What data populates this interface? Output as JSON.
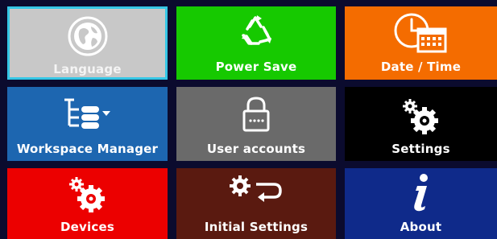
{
  "tiles": [
    {
      "id": "language",
      "label": "Language",
      "icon": "globe-icon",
      "color": "#c8c8c8",
      "selected": true
    },
    {
      "id": "power-save",
      "label": "Power Save",
      "icon": "recycle-icon",
      "color": "#16c900"
    },
    {
      "id": "date-time",
      "label": "Date / Time",
      "icon": "clock-calendar-icon",
      "color": "#f46c00"
    },
    {
      "id": "workspace-manager",
      "label": "Workspace Manager",
      "icon": "tree-list-icon",
      "color": "#1d66b0"
    },
    {
      "id": "user-accounts",
      "label": "User accounts",
      "icon": "lock-icon",
      "color": "#6a6a6a"
    },
    {
      "id": "settings",
      "label": "Settings",
      "icon": "gears-icon",
      "color": "#000000"
    },
    {
      "id": "devices",
      "label": "Devices",
      "icon": "gears-icon",
      "color": "#ec0000"
    },
    {
      "id": "initial-settings",
      "label": "Initial Settings",
      "icon": "gear-return-icon",
      "color": "#5a1a10"
    },
    {
      "id": "about",
      "label": "About",
      "icon": "info-icon",
      "color": "#0f2a8a"
    }
  ],
  "selection_outline_color": "#35c7e6"
}
